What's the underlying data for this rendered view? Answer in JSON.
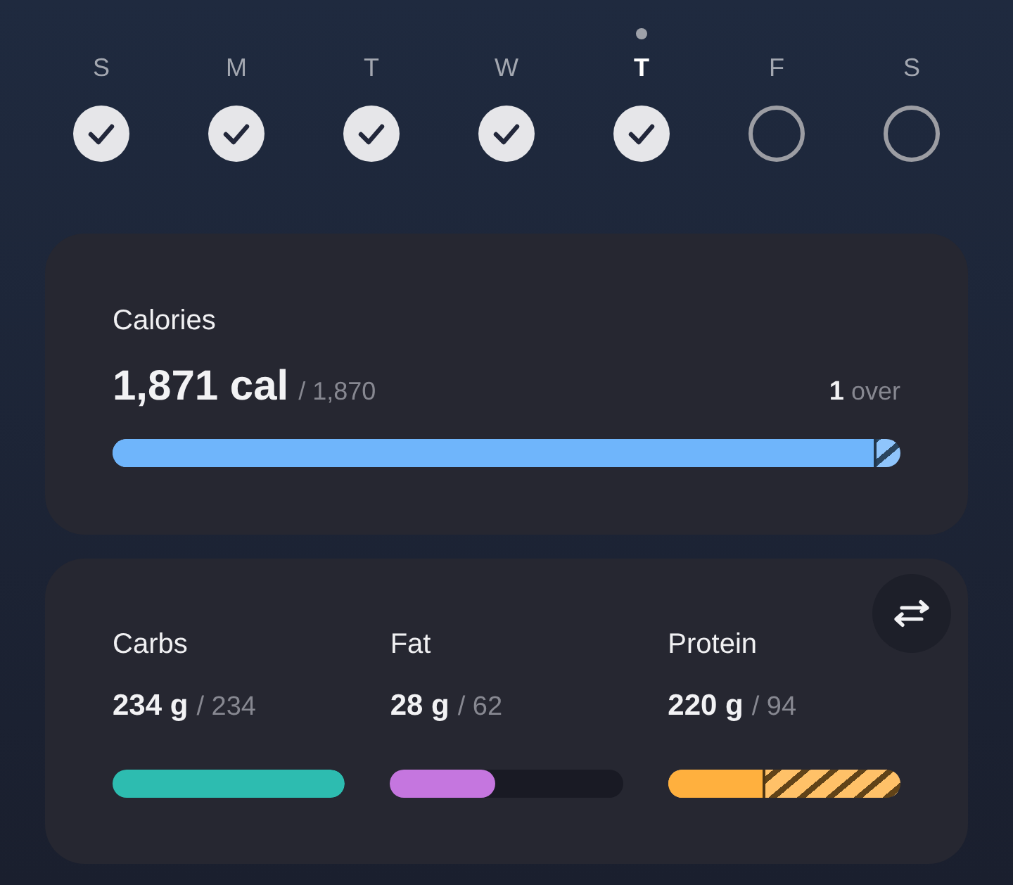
{
  "days": [
    {
      "label": "S",
      "checked": true,
      "selected": false
    },
    {
      "label": "M",
      "checked": true,
      "selected": false
    },
    {
      "label": "T",
      "checked": true,
      "selected": false
    },
    {
      "label": "W",
      "checked": true,
      "selected": false
    },
    {
      "label": "T",
      "checked": true,
      "selected": true
    },
    {
      "label": "F",
      "checked": false,
      "selected": false
    },
    {
      "label": "S",
      "checked": false,
      "selected": false
    }
  ],
  "calories": {
    "label": "Calories",
    "value": "1,871 cal",
    "goal": "/ 1,870",
    "over_amount": "1",
    "over_label": "over",
    "color": "#6fb5fb",
    "level": 0.97,
    "over": true
  },
  "macros": [
    {
      "label": "Carbs",
      "value": "234 g",
      "goal": "/ 234",
      "color": "#2dbcb0",
      "level": 1,
      "over": false
    },
    {
      "label": "Fat",
      "value": "28 g",
      "goal": "/ 62",
      "color": "#c576df",
      "level": 0.45,
      "over": false
    },
    {
      "label": "Protein",
      "value": "220 g",
      "goal": "/ 94",
      "color": "#ffb03e",
      "level": 0.42,
      "over": true
    }
  ]
}
